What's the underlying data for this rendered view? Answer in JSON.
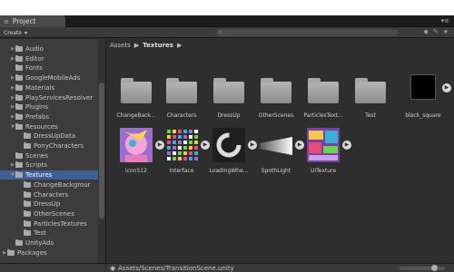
{
  "window": {
    "tab_label": "Project",
    "create_label": "Create"
  },
  "tree": {
    "items": [
      {
        "label": "Audio",
        "arrow": "▶",
        "indent": 1
      },
      {
        "label": "Editor",
        "arrow": "▶",
        "indent": 1
      },
      {
        "label": "Fonts",
        "arrow": "",
        "indent": 1
      },
      {
        "label": "GoogleMobileAds",
        "arrow": "▶",
        "indent": 1
      },
      {
        "label": "Materials",
        "arrow": "▶",
        "indent": 1
      },
      {
        "label": "PlayServicesResolver",
        "arrow": "▶",
        "indent": 1
      },
      {
        "label": "Plugins",
        "arrow": "▶",
        "indent": 1
      },
      {
        "label": "Prefabs",
        "arrow": "▶",
        "indent": 1
      },
      {
        "label": "Resources",
        "arrow": "▼",
        "indent": 1
      },
      {
        "label": "DressUpData",
        "arrow": "",
        "indent": 2
      },
      {
        "label": "PonyCharacters",
        "arrow": "",
        "indent": 2
      },
      {
        "label": "Scenes",
        "arrow": "",
        "indent": 1
      },
      {
        "label": "Scripts",
        "arrow": "▶",
        "indent": 1
      },
      {
        "label": "Textures",
        "arrow": "▼",
        "indent": 1,
        "selected": true
      },
      {
        "label": "ChangeBackgrour",
        "arrow": "",
        "indent": 2
      },
      {
        "label": "Characters",
        "arrow": "",
        "indent": 2
      },
      {
        "label": "DressUp",
        "arrow": "",
        "indent": 2
      },
      {
        "label": "OtherScenes",
        "arrow": "",
        "indent": 2
      },
      {
        "label": "ParticlesTextures",
        "arrow": "",
        "indent": 2
      },
      {
        "label": "Test",
        "arrow": "",
        "indent": 2
      },
      {
        "label": "UnityAds",
        "arrow": "",
        "indent": 1
      },
      {
        "label": "Packages",
        "arrow": "▶",
        "indent": 0
      }
    ]
  },
  "breadcrumb": {
    "root": "Assets",
    "sep1": "▶",
    "current": "Textures",
    "sep2": "▶"
  },
  "assets": {
    "row1": [
      {
        "name": "ChangeBack...",
        "kind": "folder"
      },
      {
        "name": "Characters",
        "kind": "folder"
      },
      {
        "name": "DressUp",
        "kind": "folder"
      },
      {
        "name": "OtherScenes",
        "kind": "folder"
      },
      {
        "name": "ParticlesText...",
        "kind": "folder"
      },
      {
        "name": "Test",
        "kind": "folder"
      },
      {
        "name": "black_square",
        "kind": "black"
      }
    ],
    "row2": [
      {
        "name": "icon512",
        "kind": "pony"
      },
      {
        "name": "Interface",
        "kind": "sheet"
      },
      {
        "name": "LoadingWhe...",
        "kind": "ring"
      },
      {
        "name": "SpothLight",
        "kind": "light"
      },
      {
        "name": "UITexture",
        "kind": "ui"
      }
    ]
  },
  "status": {
    "path": "Assets/Scenes/TransitionScene.unity"
  },
  "icons": {
    "menu": "hamburger-icon",
    "search": "search-icon",
    "tools": [
      "tag-icon",
      "star-icon",
      "lock-icon"
    ]
  }
}
